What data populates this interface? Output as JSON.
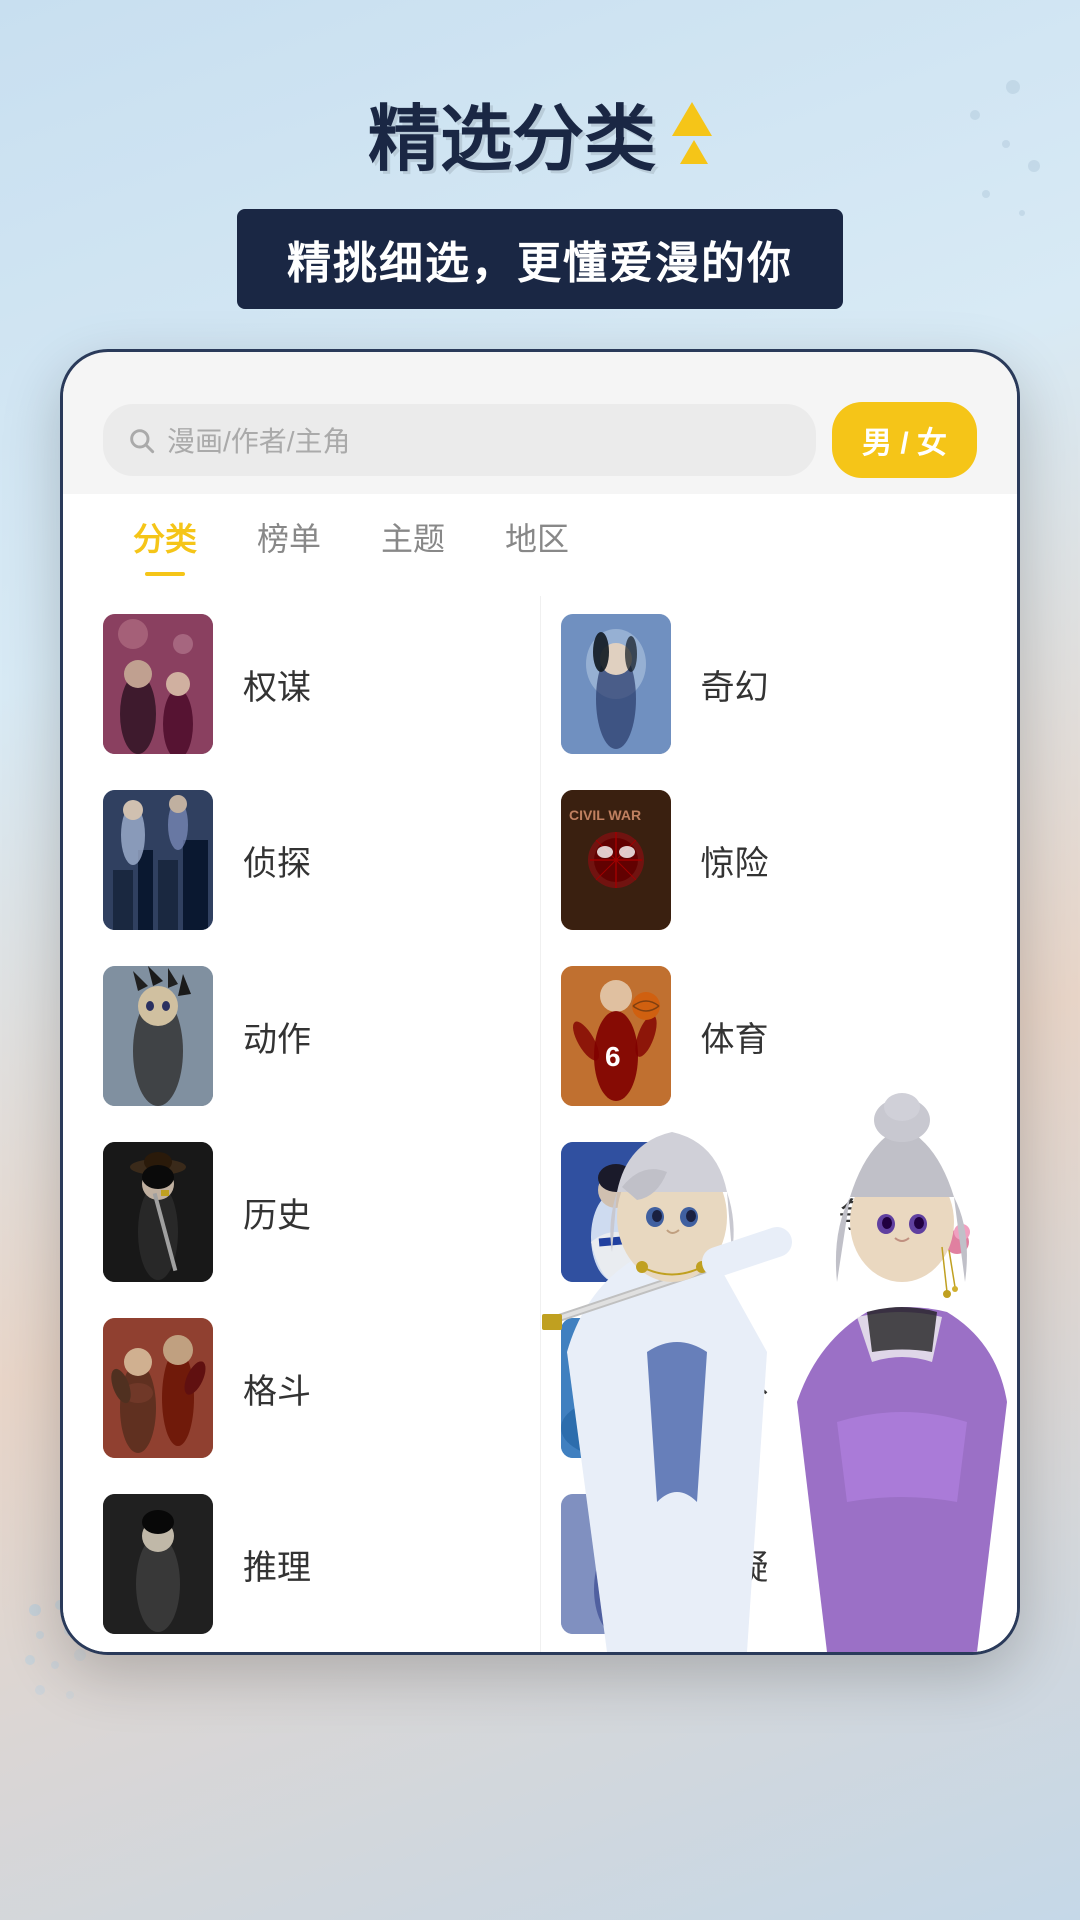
{
  "header": {
    "title": "精选分类",
    "subtitle": "精挑细选，更懂爱漫的你",
    "arrow_label": "decoration-arrows"
  },
  "search": {
    "placeholder": "漫画/作者/主角",
    "gender_toggle": "男 / 女"
  },
  "tabs": [
    {
      "id": "fenlei",
      "label": "分类",
      "active": true
    },
    {
      "id": "bangdan",
      "label": "榜单",
      "active": false
    },
    {
      "id": "zhuti",
      "label": "主题",
      "active": false
    },
    {
      "id": "diqu",
      "label": "地区",
      "active": false
    }
  ],
  "categories": [
    {
      "id": "quanmou",
      "label": "权谋",
      "cover_class": "cover-quanmou"
    },
    {
      "id": "qihuan",
      "label": "奇幻",
      "cover_class": "cover-qihuan"
    },
    {
      "id": "zhentuan",
      "label": "侦探",
      "cover_class": "cover-zhentuan"
    },
    {
      "id": "jingxian",
      "label": "惊险",
      "cover_class": "cover-jingxian"
    },
    {
      "id": "dongzuo",
      "label": "动作",
      "cover_class": "cover-dongzuo"
    },
    {
      "id": "tiyu",
      "label": "体育",
      "cover_class": "cover-tiyu"
    },
    {
      "id": "lishi",
      "label": "历史",
      "cover_class": "cover-lishi"
    },
    {
      "id": "zhanzheng",
      "label": "战争",
      "cover_class": "cover-zhanzheng"
    },
    {
      "id": "gedou",
      "label": "格斗",
      "cover_class": "cover-gedou"
    },
    {
      "id": "haiwai",
      "label": "海外",
      "cover_class": "cover-haiwai"
    },
    {
      "id": "tuili",
      "label": "推理",
      "cover_class": "cover-tuili"
    },
    {
      "id": "xuanyi",
      "label": "悬疑",
      "cover_class": "cover-xuanyi"
    }
  ]
}
